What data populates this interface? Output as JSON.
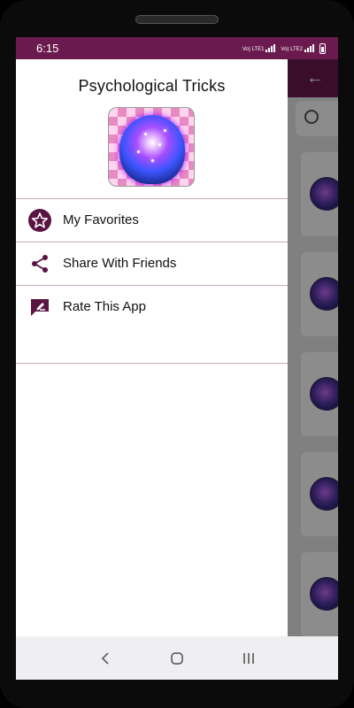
{
  "status_bar": {
    "time": "6:15",
    "sim1": "Vo) LTE1",
    "sim2": "Vo) LTE2"
  },
  "drawer": {
    "title": "Psychological Tricks",
    "menu": [
      {
        "label": "My Favorites",
        "icon": "star-icon"
      },
      {
        "label": "Share With Friends",
        "icon": "share-icon"
      },
      {
        "label": "Rate This App",
        "icon": "rate-icon"
      }
    ]
  },
  "colors": {
    "primary": "#6b1a4f",
    "divider": "#c9a9bf",
    "icon": "#5a1442"
  },
  "navbar": {
    "back": "back-nav-icon",
    "home": "home-nav-icon",
    "recents": "recents-nav-icon"
  }
}
